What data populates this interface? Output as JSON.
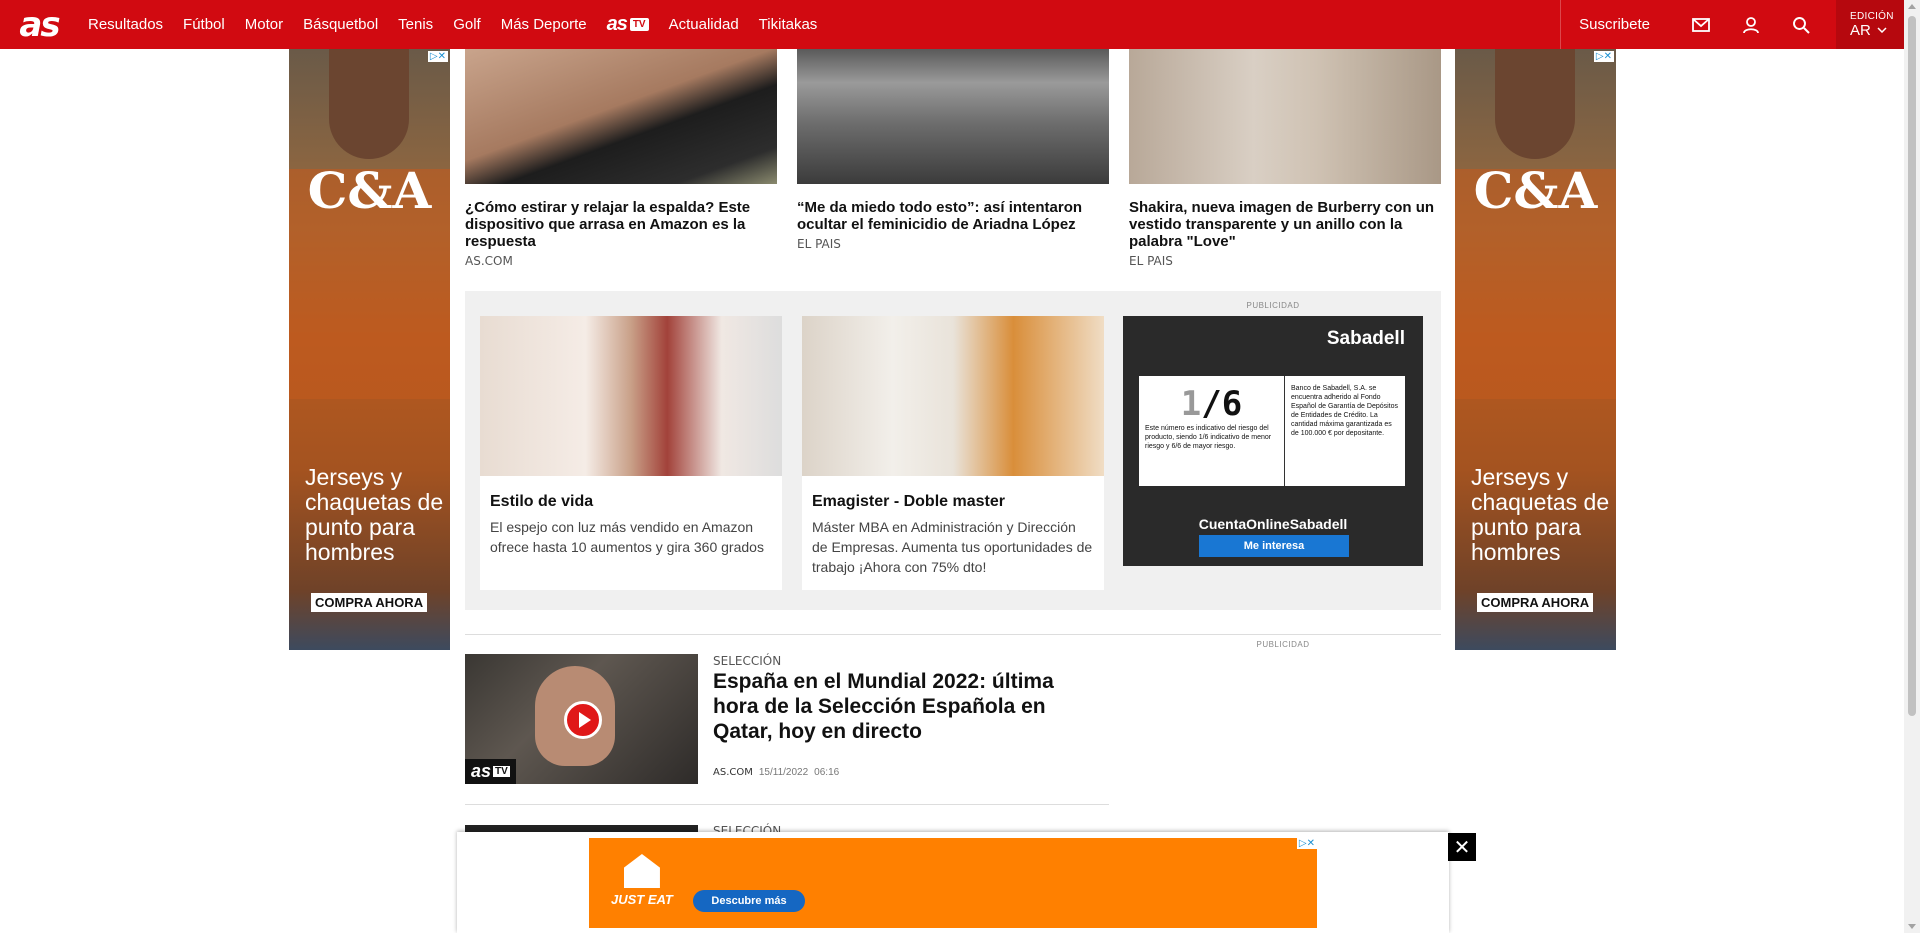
{
  "header": {
    "logo": "as",
    "nav": [
      "Resultados",
      "Fútbol",
      "Motor",
      "Básquetbol",
      "Tenis",
      "Golf",
      "Más Deporte"
    ],
    "astv_logo": "as",
    "astv_badge": "TV",
    "nav_after": [
      "Actualidad",
      "Tikitakas"
    ],
    "subscribe": "Suscribete",
    "edition_label": "EDICIÓN",
    "edition_value": "AR",
    "icons": [
      "mail-icon",
      "user-icon",
      "search-icon"
    ]
  },
  "side_ad": {
    "brand": "C&A",
    "copy": "Jerseys y chaquetas de punto para hombres",
    "cta": "COMPRA AHORA",
    "adchoice": "▷✕"
  },
  "top_cards": [
    {
      "title": "¿Cómo estirar y relajar la espalda? Este dispositivo que arrasa en Amazon es la respuesta",
      "source": "AS.COM"
    },
    {
      "title": "“Me da miedo todo esto”: así intentaron ocultar el feminicidio de Ariadna López",
      "source": "EL PAIS"
    },
    {
      "title": "Shakira, nueva imagen de Burberry con un vestido transparente y un anillo con la palabra \"Love\"",
      "source": "EL PAIS"
    }
  ],
  "promo": {
    "publicidad": "PUBLICIDAD",
    "cards": [
      {
        "title": "Estilo de vida",
        "desc": "El espejo con luz más vendido en Amazon ofrece hasta 10 aumentos y gira 360 grados"
      },
      {
        "title": "Emagister - Doble master",
        "desc": "Máster MBA en Administración y Dirección de Empresas. Aumenta tus oportunidades de trabajo ¡Ahora con 75% dto!"
      }
    ],
    "sabadell": {
      "logo": "Sabadell",
      "ratio_one": "1",
      "ratio_six": "6",
      "left_text": "Este número es indicativo del riesgo del producto, siendo 1/6 indicativo de menor riesgo y 6/6 de mayor riesgo.",
      "right_text": "Banco de Sabadell, S.A. se encuentra adherido al Fondo Español de Garantía de Depósitos de Entidades de Crédito. La cantidad máxima garantizada es de 100.000 € por depositante.",
      "cuenta": "CuentaOnlineSabadell",
      "button": "Me interesa"
    }
  },
  "article": {
    "kicker": "SELECCIÓN",
    "title": "España en el Mundial 2022: última hora de la Selección Española en Qatar, hoy en directo",
    "source": "AS.COM",
    "date": "15/11/2022",
    "time": "06:16",
    "badge": "as",
    "badge_tv": "TV",
    "kicker2": "SELECCIÓN"
  },
  "right_publicidad": "PUBLICIDAD",
  "sticky_ad": {
    "brand": "JUST EAT",
    "button": "Descubre más",
    "close": "✕"
  }
}
